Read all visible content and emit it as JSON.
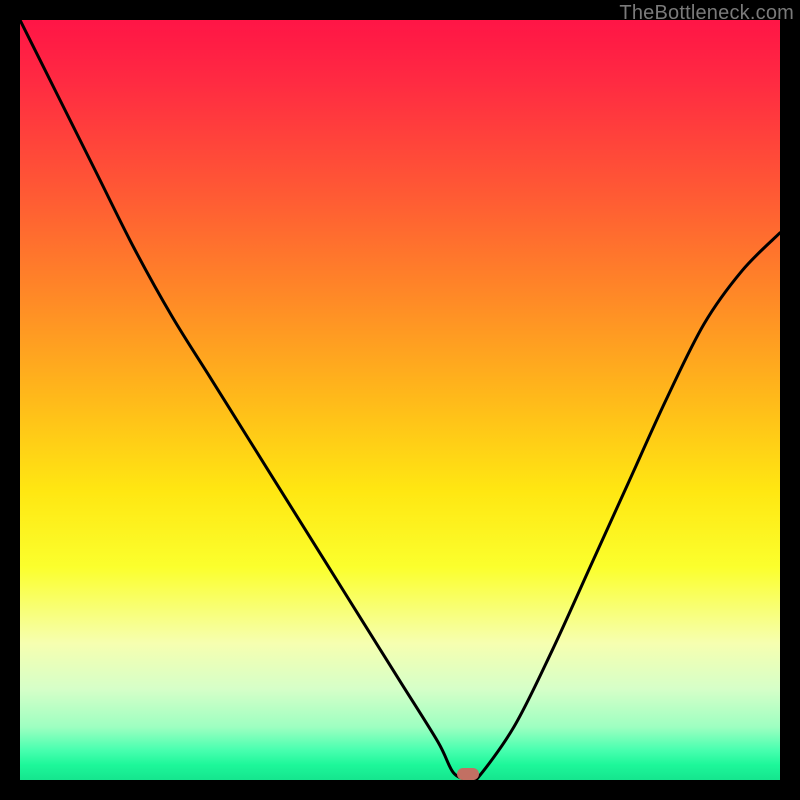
{
  "watermark": "TheBottleneck.com",
  "colors": {
    "frame": "#000000",
    "curve": "#000000",
    "marker": "#c27063",
    "gradient_stops": [
      {
        "pos": 0.0,
        "color": "#ff1546"
      },
      {
        "pos": 0.08,
        "color": "#ff2a42"
      },
      {
        "pos": 0.23,
        "color": "#ff5a34"
      },
      {
        "pos": 0.37,
        "color": "#ff8b26"
      },
      {
        "pos": 0.5,
        "color": "#ffba1a"
      },
      {
        "pos": 0.62,
        "color": "#ffe712"
      },
      {
        "pos": 0.72,
        "color": "#fbff2d"
      },
      {
        "pos": 0.82,
        "color": "#f6ffb0"
      },
      {
        "pos": 0.88,
        "color": "#d6ffc8"
      },
      {
        "pos": 0.93,
        "color": "#9effc1"
      },
      {
        "pos": 0.96,
        "color": "#4affb0"
      },
      {
        "pos": 0.98,
        "color": "#1df79a"
      },
      {
        "pos": 1.0,
        "color": "#15e58e"
      }
    ]
  },
  "chart_data": {
    "type": "line",
    "title": "",
    "xlabel": "",
    "ylabel": "",
    "xlim": [
      0,
      100
    ],
    "ylim": [
      0,
      100
    ],
    "x": [
      0,
      5,
      10,
      15,
      20,
      25,
      30,
      35,
      40,
      45,
      50,
      55,
      57,
      59,
      60,
      65,
      70,
      75,
      80,
      85,
      90,
      95,
      100
    ],
    "values": [
      100,
      90,
      80,
      70,
      61,
      53,
      45,
      37,
      29,
      21,
      13,
      5,
      1,
      0,
      0,
      7,
      17,
      28,
      39,
      50,
      60,
      67,
      72
    ],
    "minimum": {
      "x": 59,
      "y": 0
    },
    "marker": {
      "x": 59,
      "y": 0.8
    }
  }
}
